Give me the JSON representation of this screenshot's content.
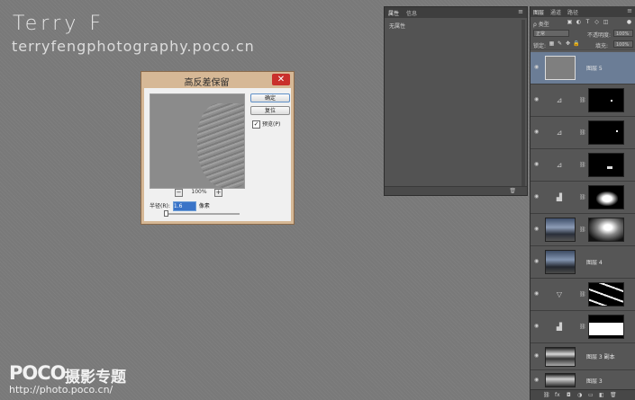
{
  "watermark": {
    "title": "Terry  F",
    "subtitle": "terryfengphotography.poco.cn",
    "logo": "POCO",
    "tagline": "摄影专题",
    "url": "http://photo.poco.cn/"
  },
  "dialog": {
    "title": "高反差保留",
    "close": "✕",
    "ok_label": "确定",
    "reset_label": "复位",
    "preview_label": "预览(P)",
    "preview_checked": "✓",
    "zoom_out": "−",
    "zoom_in": "+",
    "zoom_value": "100%",
    "radius_label": "半径(R):",
    "radius_value": "1.6",
    "radius_unit": "像素"
  },
  "properties_panel": {
    "tab_properties": "属性",
    "tab_info": "信息",
    "menu": "≡",
    "empty_text": "无属性"
  },
  "layers_panel": {
    "tab_layers": "图层",
    "tab_channels": "通道",
    "tab_paths": "路径",
    "menu": "≡",
    "filter_kind": "ρ 类型",
    "blend_mode": "正常",
    "opacity_label": "不透明度:",
    "opacity_value": "100%",
    "lock_label": "锁定:",
    "fill_label": "填充:",
    "fill_value": "100%",
    "layers": [
      {
        "name": "图层 5",
        "selected": true
      },
      {
        "name": ""
      },
      {
        "name": ""
      },
      {
        "name": ""
      },
      {
        "name": ""
      },
      {
        "name": ""
      },
      {
        "name": "图层 4"
      },
      {
        "name": ""
      },
      {
        "name": ""
      },
      {
        "name": "图层 3 副本"
      },
      {
        "name": "图层 3"
      },
      {
        "name": ""
      }
    ]
  }
}
